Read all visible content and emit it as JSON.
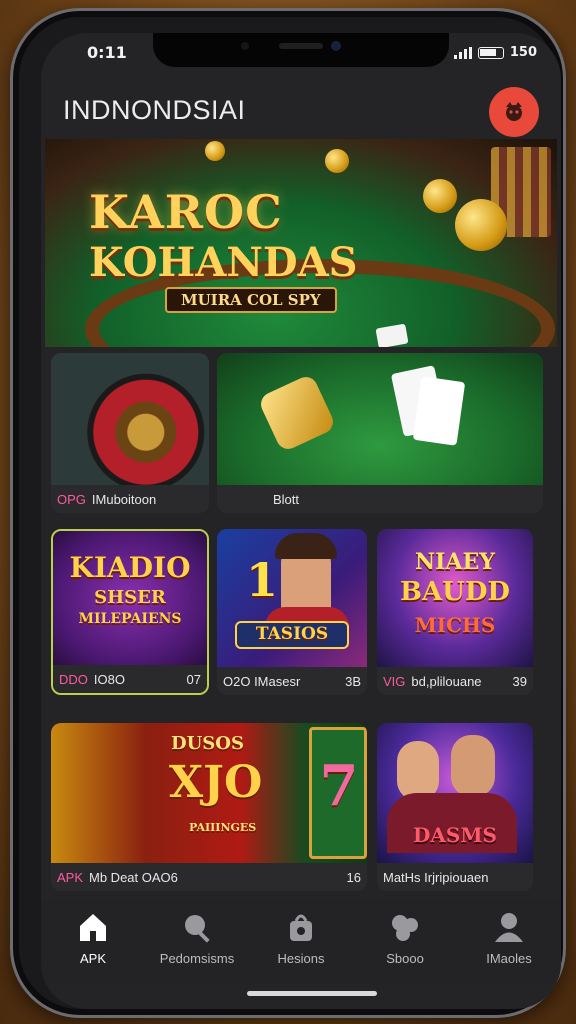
{
  "status": {
    "time": "0:11",
    "battery": "150"
  },
  "header": {
    "title": "INDNONDSIAI"
  },
  "hero": {
    "title": "KAROC",
    "subtitle": "KOHANDAS",
    "tag": "MUIRA COL SPY"
  },
  "featured": [
    {
      "badge": "OPG",
      "label": "IMuboitoon"
    },
    {
      "badge": "",
      "label": "Blott"
    }
  ],
  "row1": [
    {
      "art_line1": "KIADIO",
      "art_line2": "SHSER",
      "art_line3": "MILEPAIENS",
      "badge": "DDO",
      "label": "IO8O",
      "num": "07"
    },
    {
      "art_line1": "1",
      "art_line2": "TASIOS",
      "art_line3": "",
      "badge": "",
      "label": "O2O IMasesr",
      "num": "3B"
    },
    {
      "art_line1": "NIAEY",
      "art_line2": "BAUDD",
      "art_line3": "MICHS",
      "badge": "VIG",
      "label": "bd,plilouane",
      "num": "39"
    }
  ],
  "row2": [
    {
      "art_line1": "DUSOS",
      "art_line2": "XJO",
      "art_line3": "PAIIINGES",
      "art_line4": "7",
      "badge": "APK",
      "label": "Mb Deat OAO6",
      "num": "16"
    },
    {
      "art_line1": "DASMS",
      "badge": "",
      "label": "MatHs Irjripiouaen",
      "num": ""
    }
  ],
  "nav": [
    {
      "label": "APK",
      "icon": "home-icon"
    },
    {
      "label": "Pedomsisms",
      "icon": "search-icon"
    },
    {
      "label": "Hesions",
      "icon": "bag-icon"
    },
    {
      "label": "Sbooo",
      "icon": "gamepad-icon"
    },
    {
      "label": "IMaoles",
      "icon": "user-icon"
    }
  ],
  "colors": {
    "accent": "#e8493a",
    "gold": "#ffd24a",
    "felt": "#1f8a3a",
    "badge": "#ff5aa0"
  }
}
